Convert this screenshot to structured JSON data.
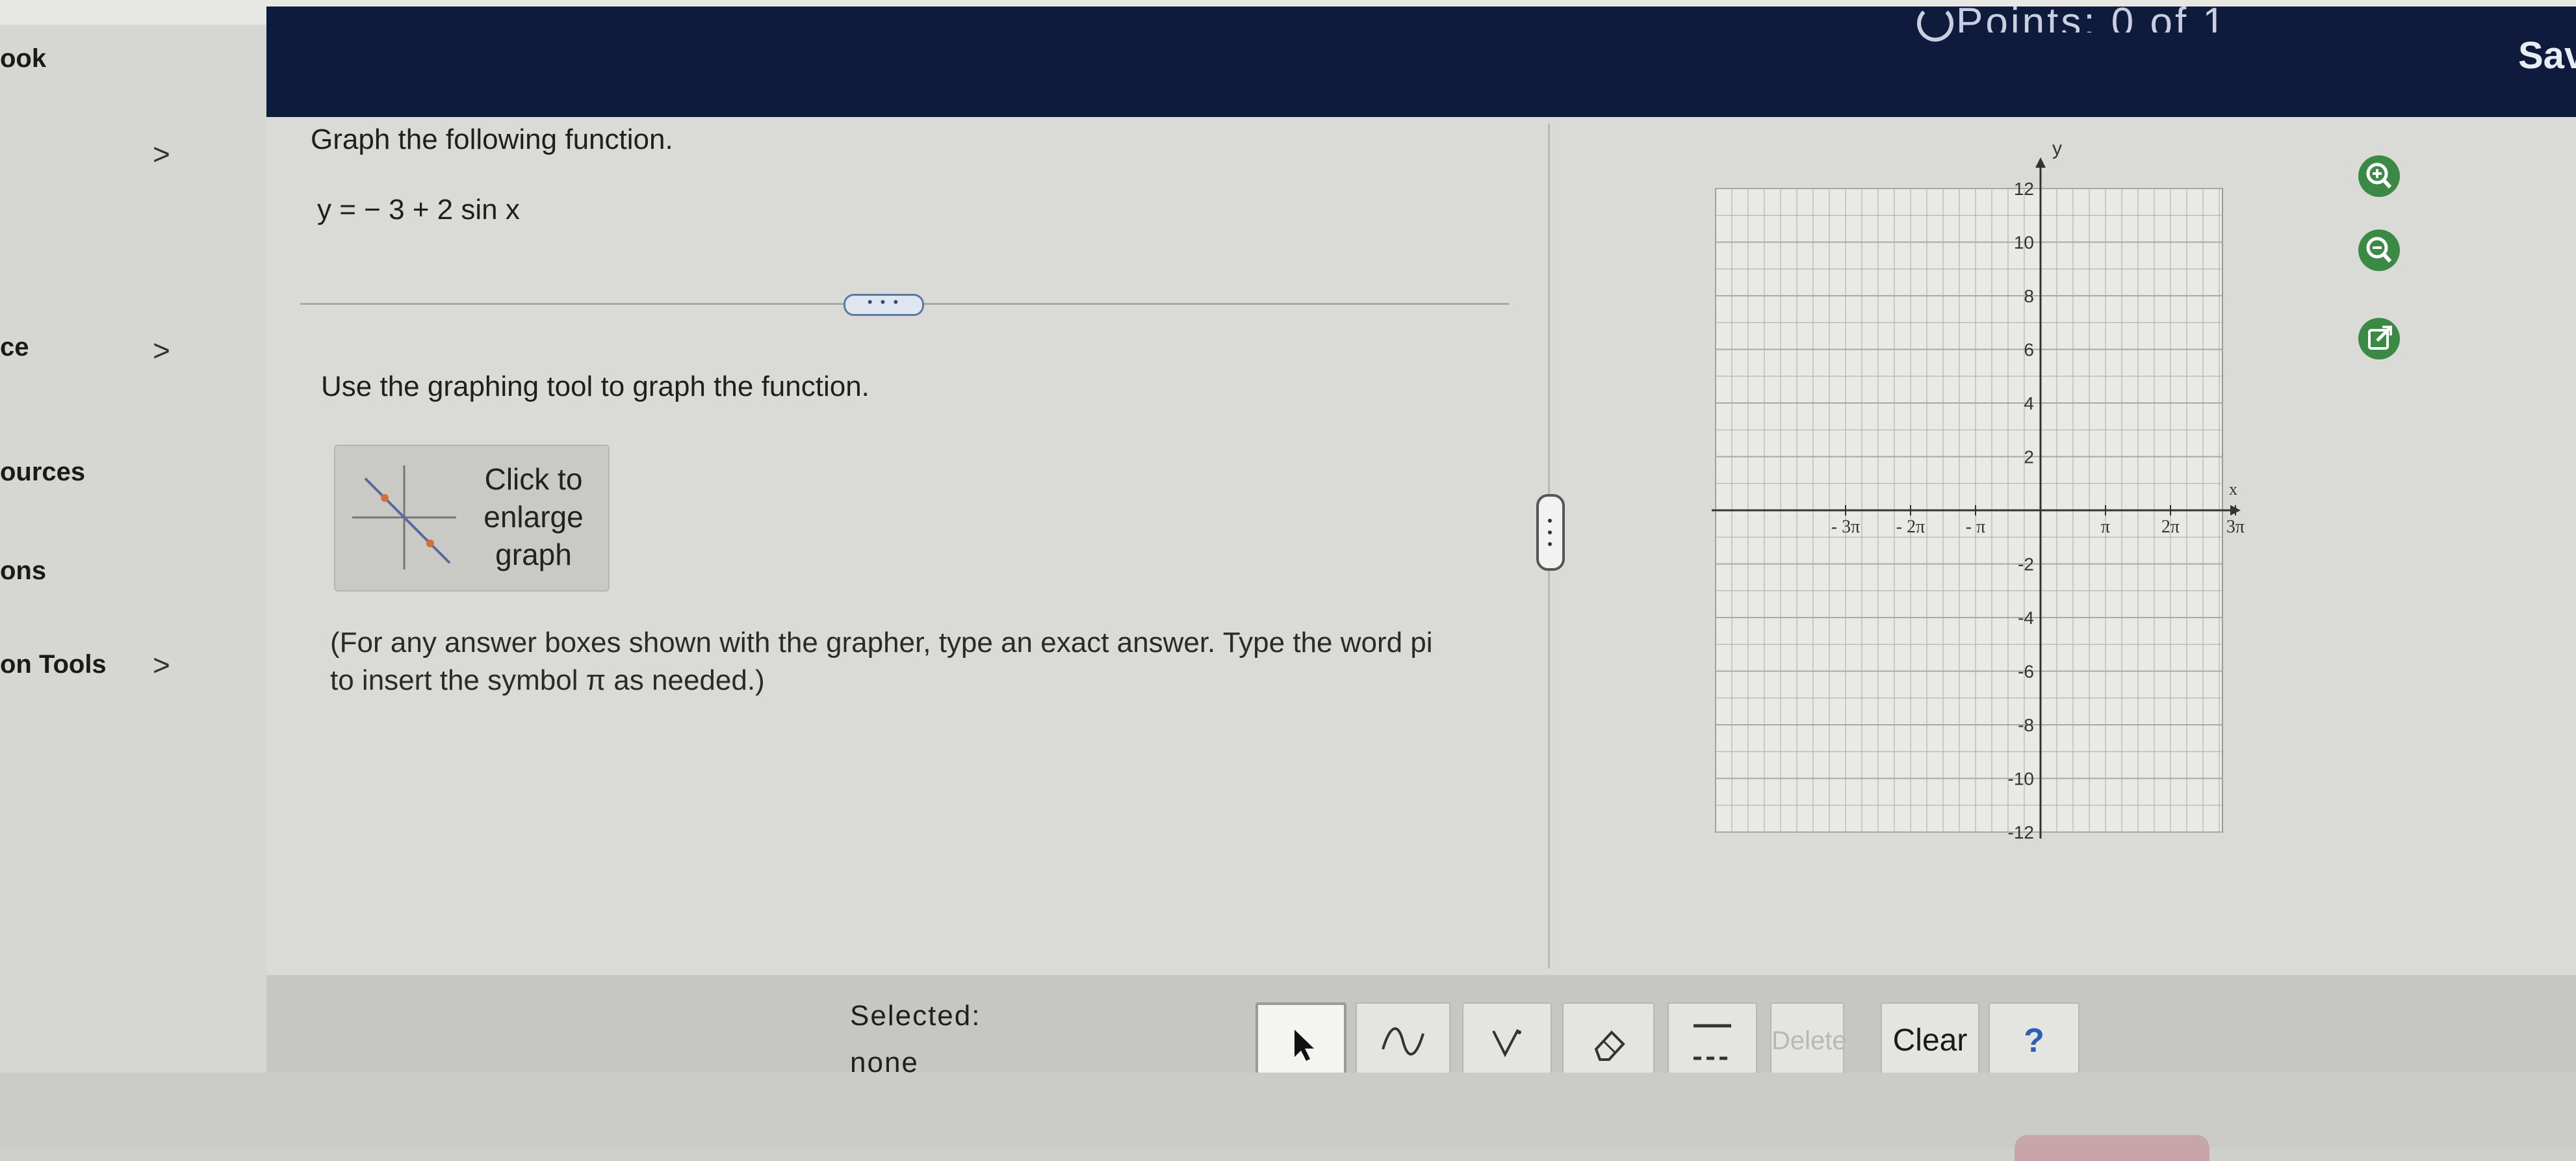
{
  "header": {
    "points_label": "Points: 0 of 1",
    "save_label": "Sav"
  },
  "sidebar": {
    "items": [
      {
        "label": "ook",
        "has_chevron": false
      },
      {
        "label": "",
        "has_chevron": true
      },
      {
        "label": "ce",
        "has_chevron": true
      },
      {
        "label": "ources",
        "has_chevron": false
      },
      {
        "label": "ons",
        "has_chevron": false
      },
      {
        "label": "on Tools",
        "has_chevron": true
      }
    ],
    "chevron_glyph": ">"
  },
  "question": {
    "title": "Graph the following function.",
    "equation": "y = − 3 + 2 sin x",
    "more_label": "• • •",
    "instruction": "Use the graphing tool to graph the function.",
    "enlarge_label": "Click to enlarge graph",
    "note_line1": "(For any answer boxes shown with the grapher, type an exact answer. Type the word pi",
    "note_line2": "to insert the symbol π as needed.)"
  },
  "graph": {
    "y_axis_label": "y",
    "x_axis_label": "x",
    "y_ticks": [
      "12",
      "10",
      "8",
      "6",
      "4",
      "2",
      "-2",
      "-4",
      "-6",
      "-8",
      "-10",
      "-12"
    ],
    "x_ticks": [
      "- 3π",
      "- 2π",
      "- π",
      "π",
      "2π",
      "3π"
    ],
    "ylim": [
      -12,
      12
    ],
    "xlim_pi": [
      -3.5,
      3.5
    ]
  },
  "graph_tools": {
    "zoom_in_icon": "zoom-in-icon",
    "zoom_out_icon": "zoom-out-icon",
    "popout_icon": "external-link-icon",
    "accent": "#2f7a3a"
  },
  "toolbar": {
    "selected_label": "Selected:",
    "selected_value": "none",
    "tools": [
      {
        "name": "pointer-tool",
        "icon": "arrow-pointer-icon"
      },
      {
        "name": "sine-tool",
        "icon": "sine-wave-icon"
      },
      {
        "name": "absolute-tool",
        "icon": "v-shape-icon"
      },
      {
        "name": "eraser-tool",
        "icon": "eraser-icon"
      },
      {
        "name": "line-style-tool",
        "icon": "solid-dashed-line-icon"
      }
    ],
    "delete_label": "Delete",
    "clear_label": "Clear",
    "help_label": "?"
  }
}
